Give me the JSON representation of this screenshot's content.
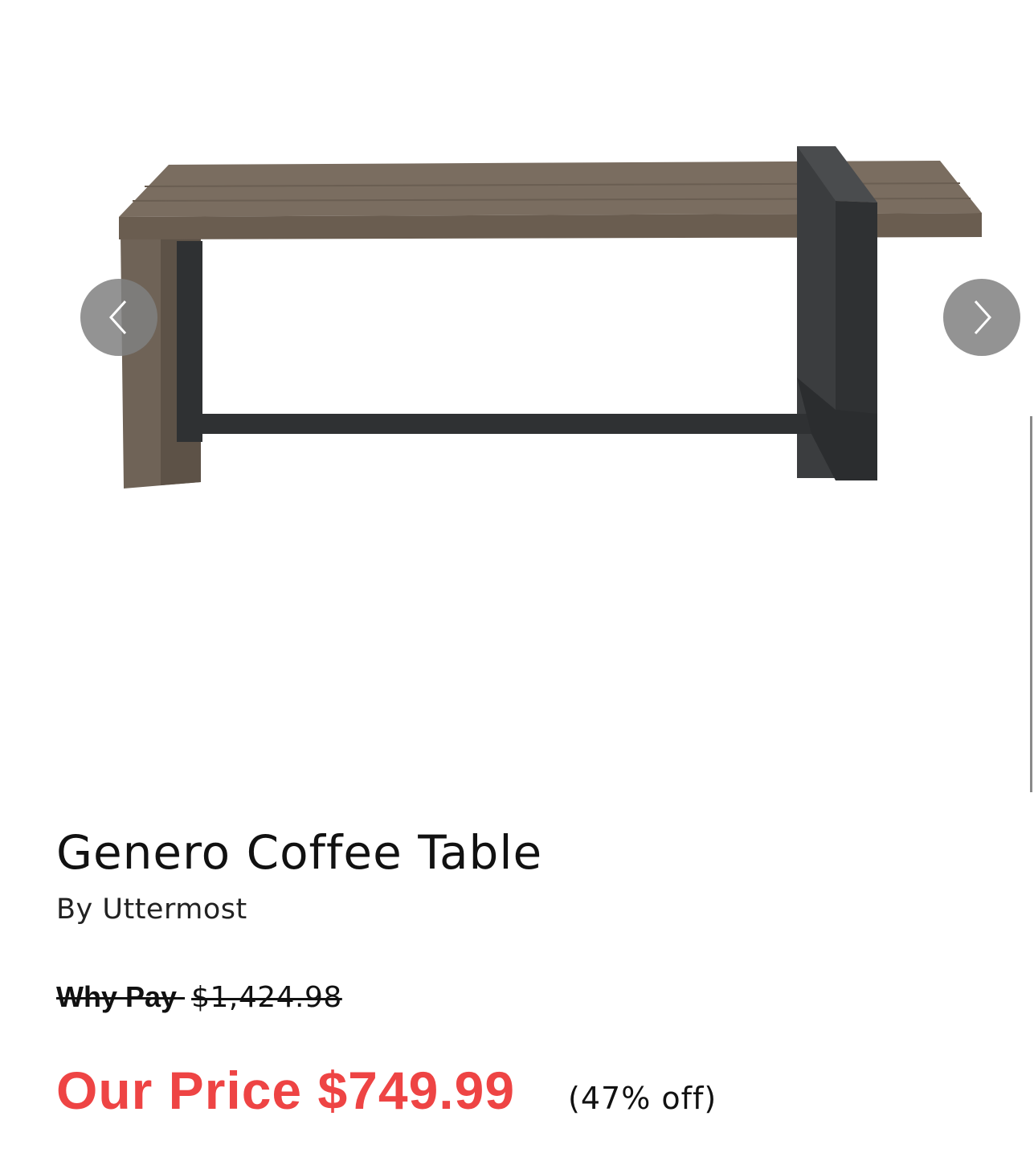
{
  "gallery": {
    "image_name": "coffee-table-photo",
    "prev_icon": "chevron-left-icon",
    "next_icon": "chevron-right-icon"
  },
  "product": {
    "title": "Genero Coffee Table",
    "brand": "By Uttermost"
  },
  "pricing": {
    "was_label": "Why Pay",
    "was_amount": "$1,424.98",
    "our_price": "Our Price $749.99",
    "discount": "(47% off)",
    "accent_color": "#EE4444"
  }
}
